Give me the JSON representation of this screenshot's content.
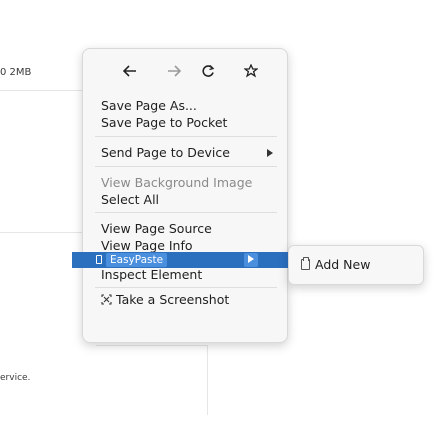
{
  "background": {
    "size_text": "0 2MB",
    "footer_text": "ervice."
  },
  "menu": {
    "nav": {
      "back": "back-arrow",
      "forward": "forward-arrow",
      "reload": "reload",
      "bookmark": "bookmark-star"
    },
    "save_page_as": "Save Page As...",
    "save_to_pocket": "Save Page to Pocket",
    "send_to_device": "Send Page to Device",
    "view_background_image": "View Background Image",
    "select_all": "Select All",
    "view_page_source": "View Page Source",
    "view_page_info": "View Page Info",
    "inspect_element": "Inspect Element",
    "take_screenshot": "Take a Screenshot",
    "easypaste": "EasyPaste"
  },
  "submenu": {
    "add_new": "Add New"
  },
  "colors": {
    "highlight": "#2b6fbf",
    "highlight_light": "#4a8fde",
    "menu_bg": "#f7f7f7"
  }
}
